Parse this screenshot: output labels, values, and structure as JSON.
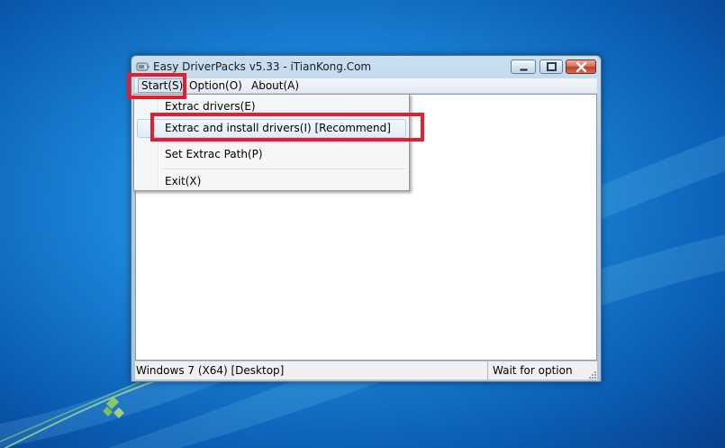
{
  "window": {
    "title": "Easy DriverPacks v5.33 - iTianKong.Com"
  },
  "menubar": {
    "items": [
      {
        "label": "Start(S)"
      },
      {
        "label": "Option(O)"
      },
      {
        "label": "About(A)"
      }
    ]
  },
  "dropdown": {
    "items": [
      {
        "label": "Extrac drivers(E)"
      },
      {
        "label": "Extrac and install drivers(I) [Recommend]"
      },
      {
        "label": "Set Extrac Path(P)"
      },
      {
        "label": "Exit(X)"
      }
    ]
  },
  "statusbar": {
    "left": "Windows 7 (X64) [Desktop]",
    "right": "Wait for option"
  },
  "colors": {
    "highlight_red": "#e0202e",
    "desktop_blue": "#1a84d6"
  }
}
